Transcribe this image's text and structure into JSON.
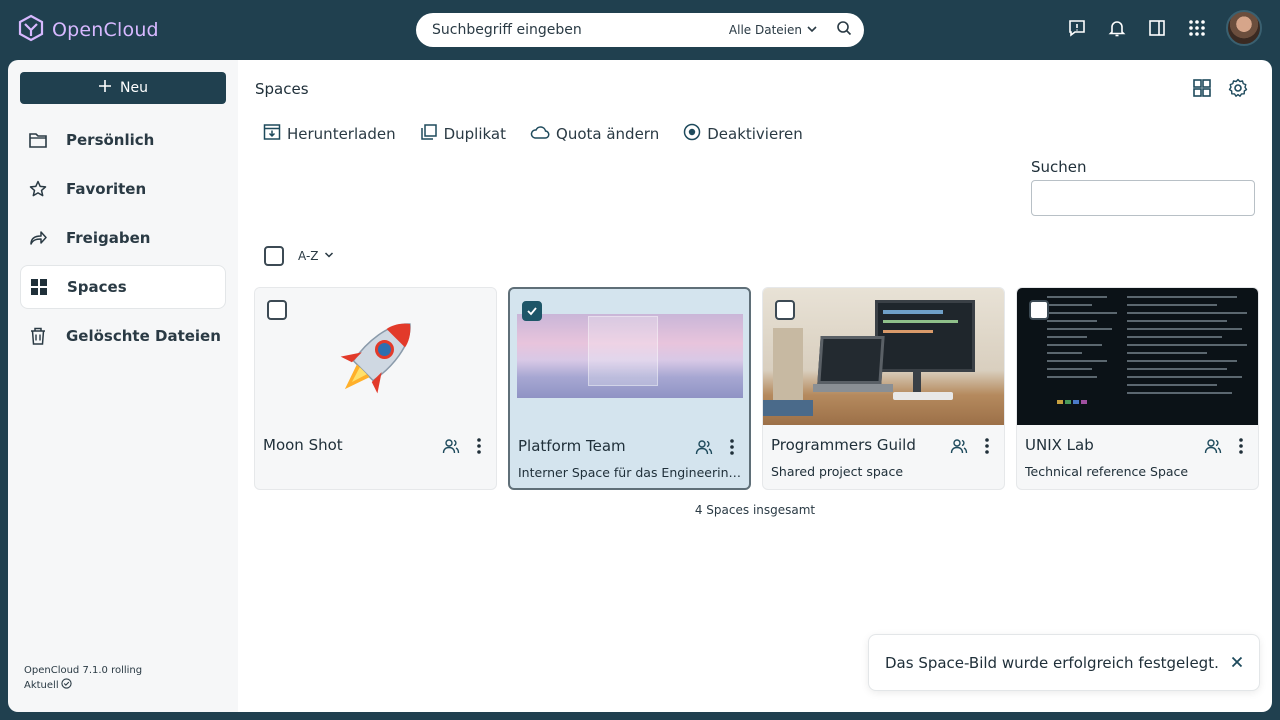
{
  "app": {
    "name": "OpenCloud"
  },
  "search": {
    "placeholder": "Suchbegriff eingeben",
    "scope": "Alle Dateien"
  },
  "sidebar": {
    "new_label": "Neu",
    "items": [
      {
        "label": "Persönlich",
        "icon": "folder-icon"
      },
      {
        "label": "Favoriten",
        "icon": "star-icon"
      },
      {
        "label": "Freigaben",
        "icon": "share-icon"
      },
      {
        "label": "Spaces",
        "icon": "grid-icon",
        "active": true
      },
      {
        "label": "Gelöschte Dateien",
        "icon": "trash-icon"
      }
    ],
    "version": "OpenCloud 7.1.0 rolling",
    "status": "Aktuell"
  },
  "main": {
    "title": "Spaces",
    "actions": [
      {
        "label": "Herunterladen",
        "icon": "download-icon"
      },
      {
        "label": "Duplikat",
        "icon": "duplicate-icon"
      },
      {
        "label": "Quota ändern",
        "icon": "cloud-icon"
      },
      {
        "label": "Deaktivieren",
        "icon": "disable-icon"
      }
    ],
    "filter_label": "Suchen",
    "sort_label": "A-Z",
    "spaces": [
      {
        "name": "Moon Shot",
        "description": "",
        "checked": false
      },
      {
        "name": "Platform Team",
        "description": "Interner Space für das Engineering-Team",
        "checked": true
      },
      {
        "name": "Programmers Guild",
        "description": "Shared project space",
        "checked": false
      },
      {
        "name": "UNIX Lab",
        "description": "Technical reference Space",
        "checked": false
      }
    ],
    "total": "4 Spaces insgesamt"
  },
  "toast": {
    "message": "Das Space-Bild wurde erfolgreich festgelegt."
  },
  "colors": {
    "header_bg": "#20404f",
    "accent": "#1e5668",
    "logo": "#d7b8ff"
  }
}
